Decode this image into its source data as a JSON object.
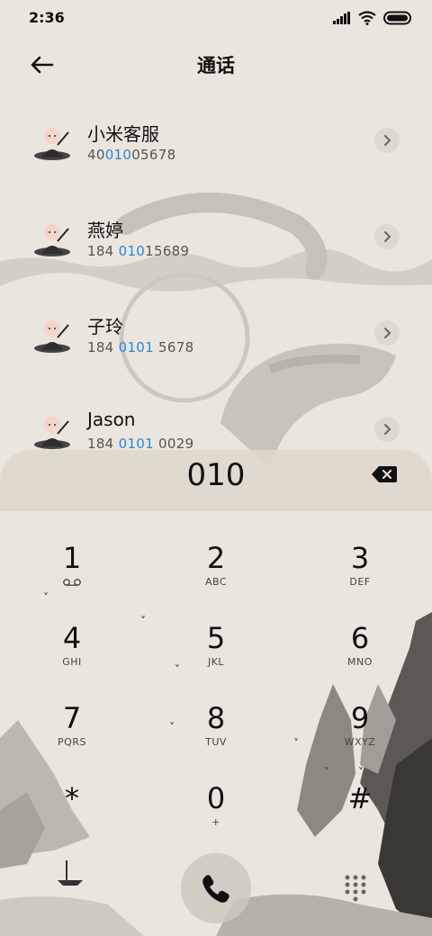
{
  "status": {
    "time": "2:36"
  },
  "header": {
    "title": "通话"
  },
  "contacts": [
    {
      "name": "小米客服",
      "number_pre": "40",
      "number_hl": "010",
      "number_post": "05678"
    },
    {
      "name": "燕婷",
      "number_pre": "184 ",
      "number_hl": "010",
      "number_post": "15689"
    },
    {
      "name": "子玲",
      "number_pre": "184 ",
      "number_hl": "0101",
      "number_post": " 5678"
    },
    {
      "name": "Jason",
      "number_pre": "184 ",
      "number_hl": "0101",
      "number_post": " 0029"
    }
  ],
  "dialer": {
    "input": "010",
    "keys": [
      {
        "digit": "1",
        "letters": ""
      },
      {
        "digit": "2",
        "letters": "ABC"
      },
      {
        "digit": "3",
        "letters": "DEF"
      },
      {
        "digit": "4",
        "letters": "GHI"
      },
      {
        "digit": "5",
        "letters": "JKL"
      },
      {
        "digit": "6",
        "letters": "MNO"
      },
      {
        "digit": "7",
        "letters": "PQRS"
      },
      {
        "digit": "8",
        "letters": "TUV"
      },
      {
        "digit": "9",
        "letters": "WXYZ"
      },
      {
        "digit": "*",
        "letters": ""
      },
      {
        "digit": "0",
        "letters": "+"
      },
      {
        "digit": "#",
        "letters": ""
      }
    ]
  }
}
